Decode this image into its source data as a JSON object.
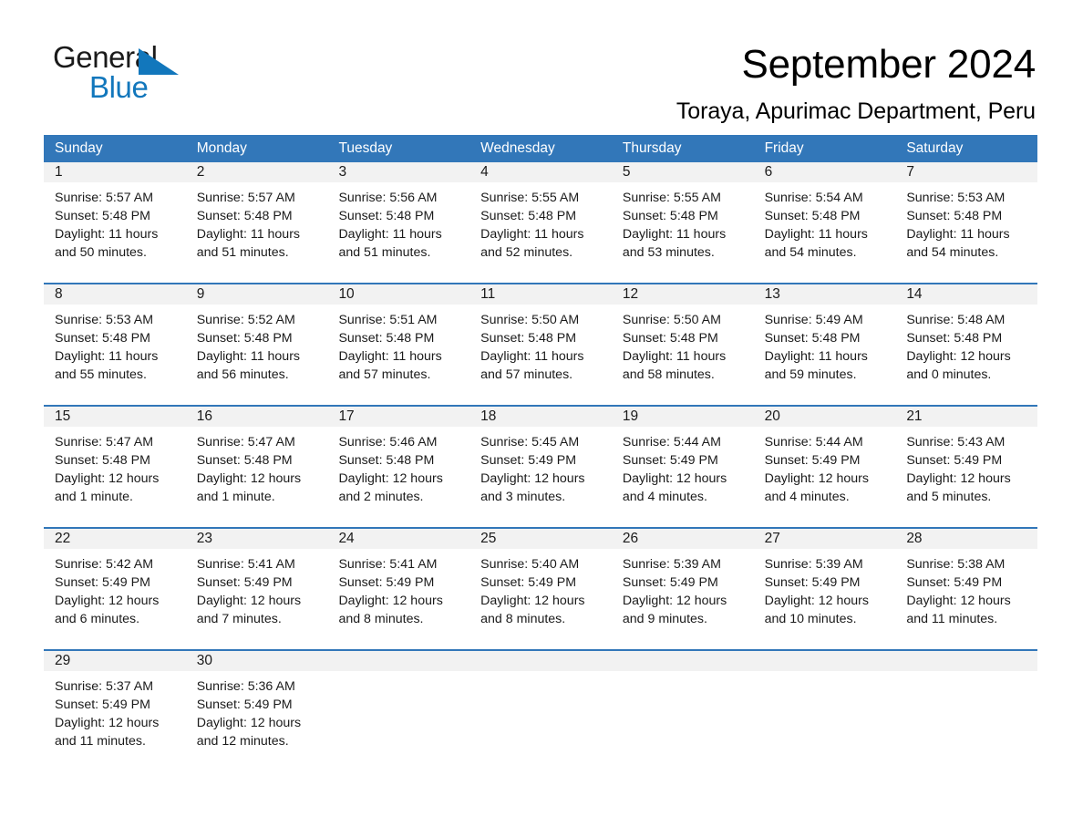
{
  "brand": {
    "name_part1": "General",
    "name_part2": "Blue",
    "accent_color": "#1277bc"
  },
  "header": {
    "month_title": "September 2024",
    "location": "Toraya, Apurimac Department, Peru"
  },
  "calendar": {
    "header_bg": "#3277b9",
    "day_number_bg": "#f2f2f2",
    "weekdays": [
      "Sunday",
      "Monday",
      "Tuesday",
      "Wednesday",
      "Thursday",
      "Friday",
      "Saturday"
    ],
    "weeks": [
      {
        "days": [
          {
            "number": "1",
            "sunrise": "Sunrise: 5:57 AM",
            "sunset": "Sunset: 5:48 PM",
            "daylight": "Daylight: 11 hours and 50 minutes."
          },
          {
            "number": "2",
            "sunrise": "Sunrise: 5:57 AM",
            "sunset": "Sunset: 5:48 PM",
            "daylight": "Daylight: 11 hours and 51 minutes."
          },
          {
            "number": "3",
            "sunrise": "Sunrise: 5:56 AM",
            "sunset": "Sunset: 5:48 PM",
            "daylight": "Daylight: 11 hours and 51 minutes."
          },
          {
            "number": "4",
            "sunrise": "Sunrise: 5:55 AM",
            "sunset": "Sunset: 5:48 PM",
            "daylight": "Daylight: 11 hours and 52 minutes."
          },
          {
            "number": "5",
            "sunrise": "Sunrise: 5:55 AM",
            "sunset": "Sunset: 5:48 PM",
            "daylight": "Daylight: 11 hours and 53 minutes."
          },
          {
            "number": "6",
            "sunrise": "Sunrise: 5:54 AM",
            "sunset": "Sunset: 5:48 PM",
            "daylight": "Daylight: 11 hours and 54 minutes."
          },
          {
            "number": "7",
            "sunrise": "Sunrise: 5:53 AM",
            "sunset": "Sunset: 5:48 PM",
            "daylight": "Daylight: 11 hours and 54 minutes."
          }
        ]
      },
      {
        "days": [
          {
            "number": "8",
            "sunrise": "Sunrise: 5:53 AM",
            "sunset": "Sunset: 5:48 PM",
            "daylight": "Daylight: 11 hours and 55 minutes."
          },
          {
            "number": "9",
            "sunrise": "Sunrise: 5:52 AM",
            "sunset": "Sunset: 5:48 PM",
            "daylight": "Daylight: 11 hours and 56 minutes."
          },
          {
            "number": "10",
            "sunrise": "Sunrise: 5:51 AM",
            "sunset": "Sunset: 5:48 PM",
            "daylight": "Daylight: 11 hours and 57 minutes."
          },
          {
            "number": "11",
            "sunrise": "Sunrise: 5:50 AM",
            "sunset": "Sunset: 5:48 PM",
            "daylight": "Daylight: 11 hours and 57 minutes."
          },
          {
            "number": "12",
            "sunrise": "Sunrise: 5:50 AM",
            "sunset": "Sunset: 5:48 PM",
            "daylight": "Daylight: 11 hours and 58 minutes."
          },
          {
            "number": "13",
            "sunrise": "Sunrise: 5:49 AM",
            "sunset": "Sunset: 5:48 PM",
            "daylight": "Daylight: 11 hours and 59 minutes."
          },
          {
            "number": "14",
            "sunrise": "Sunrise: 5:48 AM",
            "sunset": "Sunset: 5:48 PM",
            "daylight": "Daylight: 12 hours and 0 minutes."
          }
        ]
      },
      {
        "days": [
          {
            "number": "15",
            "sunrise": "Sunrise: 5:47 AM",
            "sunset": "Sunset: 5:48 PM",
            "daylight": "Daylight: 12 hours and 1 minute."
          },
          {
            "number": "16",
            "sunrise": "Sunrise: 5:47 AM",
            "sunset": "Sunset: 5:48 PM",
            "daylight": "Daylight: 12 hours and 1 minute."
          },
          {
            "number": "17",
            "sunrise": "Sunrise: 5:46 AM",
            "sunset": "Sunset: 5:48 PM",
            "daylight": "Daylight: 12 hours and 2 minutes."
          },
          {
            "number": "18",
            "sunrise": "Sunrise: 5:45 AM",
            "sunset": "Sunset: 5:49 PM",
            "daylight": "Daylight: 12 hours and 3 minutes."
          },
          {
            "number": "19",
            "sunrise": "Sunrise: 5:44 AM",
            "sunset": "Sunset: 5:49 PM",
            "daylight": "Daylight: 12 hours and 4 minutes."
          },
          {
            "number": "20",
            "sunrise": "Sunrise: 5:44 AM",
            "sunset": "Sunset: 5:49 PM",
            "daylight": "Daylight: 12 hours and 4 minutes."
          },
          {
            "number": "21",
            "sunrise": "Sunrise: 5:43 AM",
            "sunset": "Sunset: 5:49 PM",
            "daylight": "Daylight: 12 hours and 5 minutes."
          }
        ]
      },
      {
        "days": [
          {
            "number": "22",
            "sunrise": "Sunrise: 5:42 AM",
            "sunset": "Sunset: 5:49 PM",
            "daylight": "Daylight: 12 hours and 6 minutes."
          },
          {
            "number": "23",
            "sunrise": "Sunrise: 5:41 AM",
            "sunset": "Sunset: 5:49 PM",
            "daylight": "Daylight: 12 hours and 7 minutes."
          },
          {
            "number": "24",
            "sunrise": "Sunrise: 5:41 AM",
            "sunset": "Sunset: 5:49 PM",
            "daylight": "Daylight: 12 hours and 8 minutes."
          },
          {
            "number": "25",
            "sunrise": "Sunrise: 5:40 AM",
            "sunset": "Sunset: 5:49 PM",
            "daylight": "Daylight: 12 hours and 8 minutes."
          },
          {
            "number": "26",
            "sunrise": "Sunrise: 5:39 AM",
            "sunset": "Sunset: 5:49 PM",
            "daylight": "Daylight: 12 hours and 9 minutes."
          },
          {
            "number": "27",
            "sunrise": "Sunrise: 5:39 AM",
            "sunset": "Sunset: 5:49 PM",
            "daylight": "Daylight: 12 hours and 10 minutes."
          },
          {
            "number": "28",
            "sunrise": "Sunrise: 5:38 AM",
            "sunset": "Sunset: 5:49 PM",
            "daylight": "Daylight: 12 hours and 11 minutes."
          }
        ]
      },
      {
        "days": [
          {
            "number": "29",
            "sunrise": "Sunrise: 5:37 AM",
            "sunset": "Sunset: 5:49 PM",
            "daylight": "Daylight: 12 hours and 11 minutes."
          },
          {
            "number": "30",
            "sunrise": "Sunrise: 5:36 AM",
            "sunset": "Sunset: 5:49 PM",
            "daylight": "Daylight: 12 hours and 12 minutes."
          },
          {
            "number": "",
            "sunrise": "",
            "sunset": "",
            "daylight": ""
          },
          {
            "number": "",
            "sunrise": "",
            "sunset": "",
            "daylight": ""
          },
          {
            "number": "",
            "sunrise": "",
            "sunset": "",
            "daylight": ""
          },
          {
            "number": "",
            "sunrise": "",
            "sunset": "",
            "daylight": ""
          },
          {
            "number": "",
            "sunrise": "",
            "sunset": "",
            "daylight": ""
          }
        ]
      }
    ]
  }
}
